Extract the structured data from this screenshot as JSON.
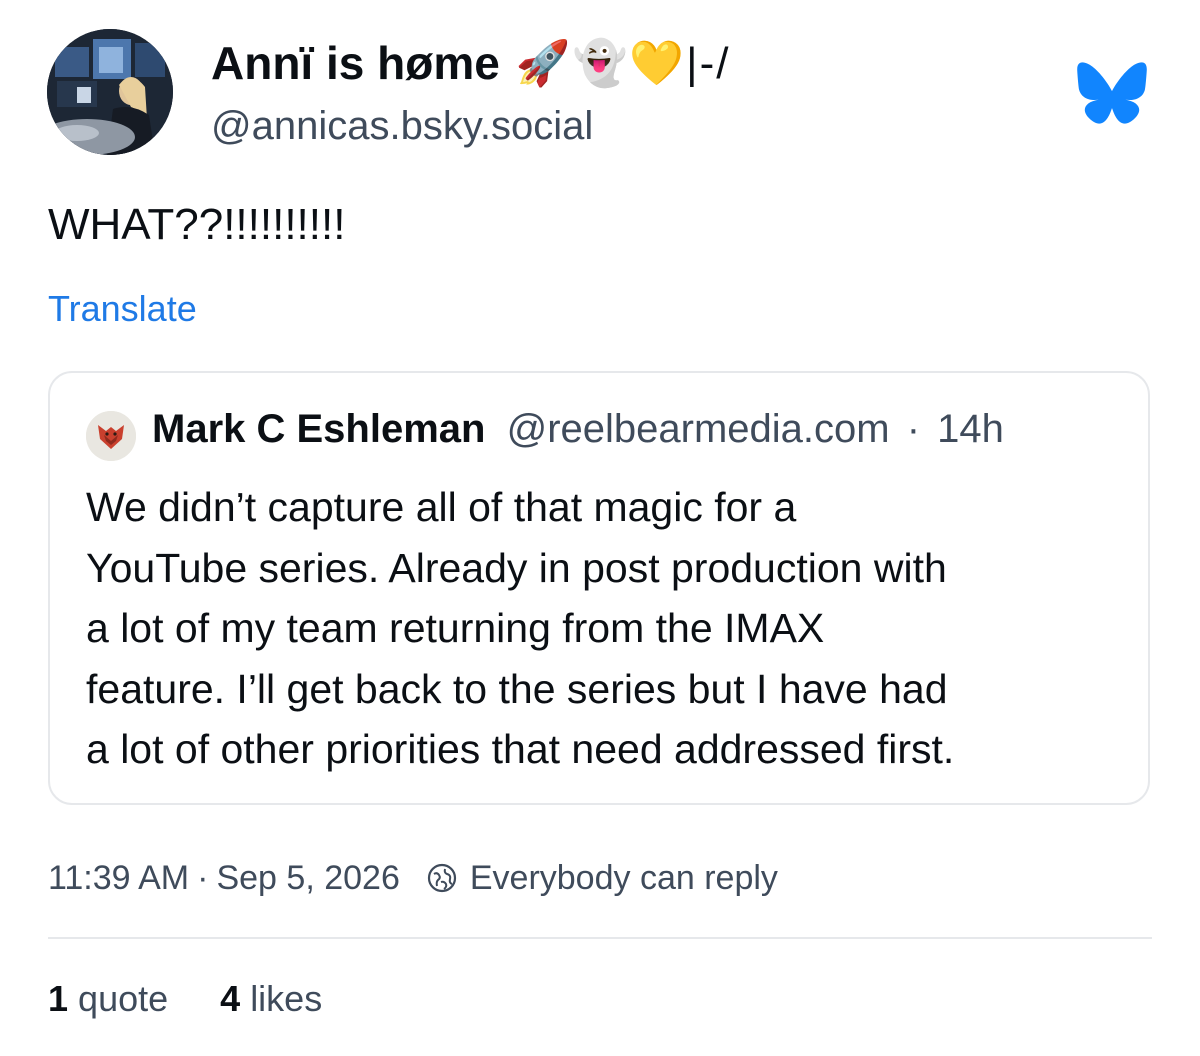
{
  "post": {
    "author": {
      "display_name": "Annï is høme",
      "name_emojis": "🚀👻💛|-/",
      "handle": "@annicas.bsky.social"
    },
    "text": "WHAT??!!!!!!!!!!",
    "translate_label": "Translate",
    "quote": {
      "author": "Mark C Eshleman",
      "handle": "@reelbearmedia.com",
      "separator": "·",
      "time": "14h",
      "lines": [
        "We didn’t capture all of that magic for a",
        "YouTube series. Already in post production with",
        "a lot of my team returning from the IMAX",
        "feature. I’ll get back to the series but I have had",
        "a lot of other priorities that need addressed first."
      ]
    },
    "meta": {
      "time": "11:39 AM",
      "separator": "·",
      "date": "Sep 5, 2026",
      "reply_setting": "Everybody can reply"
    },
    "stats": {
      "quotes_count": "1",
      "quotes_label": "quote",
      "likes_count": "4",
      "likes_label": "likes"
    }
  },
  "colors": {
    "brand_blue": "#1185fe",
    "link_blue": "#1f7ae6",
    "secondary_text": "#3f4b5b",
    "border": "#e6e8eb"
  }
}
